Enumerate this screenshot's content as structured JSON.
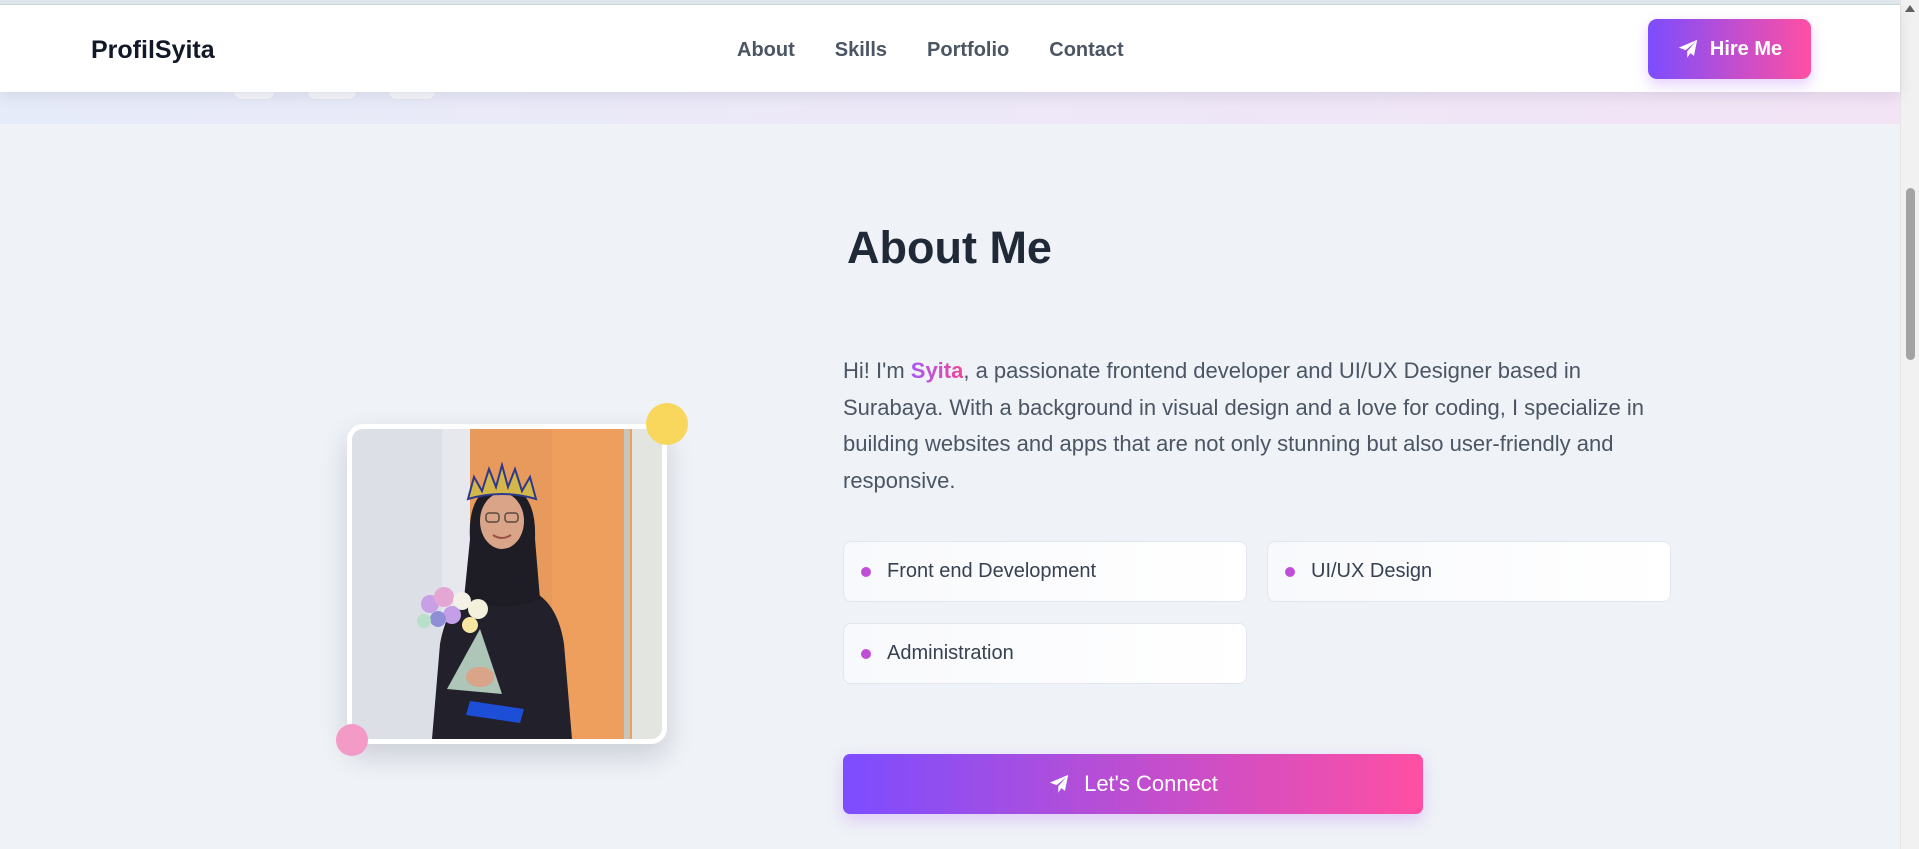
{
  "navbar": {
    "brand": "ProfilSyita",
    "links": [
      "About",
      "Skills",
      "Portfolio",
      "Contact"
    ],
    "cta_label": "Hire Me",
    "cta_icon": "paper-plane-icon"
  },
  "about": {
    "title": "About Me",
    "intro_prefix": "Hi! I'm ",
    "name": "Syita",
    "intro_suffix": ", a passionate frontend developer and UI/UX Designer based in Surabaya. With a background in visual design and a love for coding, I specialize in building websites and apps that are not only stunning but also user-friendly and responsive.",
    "skills": [
      "Front end Development",
      "UI/UX Design",
      "Administration"
    ],
    "cta_label": "Let's Connect",
    "cta_icon": "paper-plane-icon"
  },
  "colors": {
    "gradient_start": "#7c4dff",
    "gradient_end": "#ff4fa3",
    "accent_dot": "#c04ed6",
    "yellow_dot": "#f9d65c",
    "pink_dot": "#f49ac7"
  }
}
